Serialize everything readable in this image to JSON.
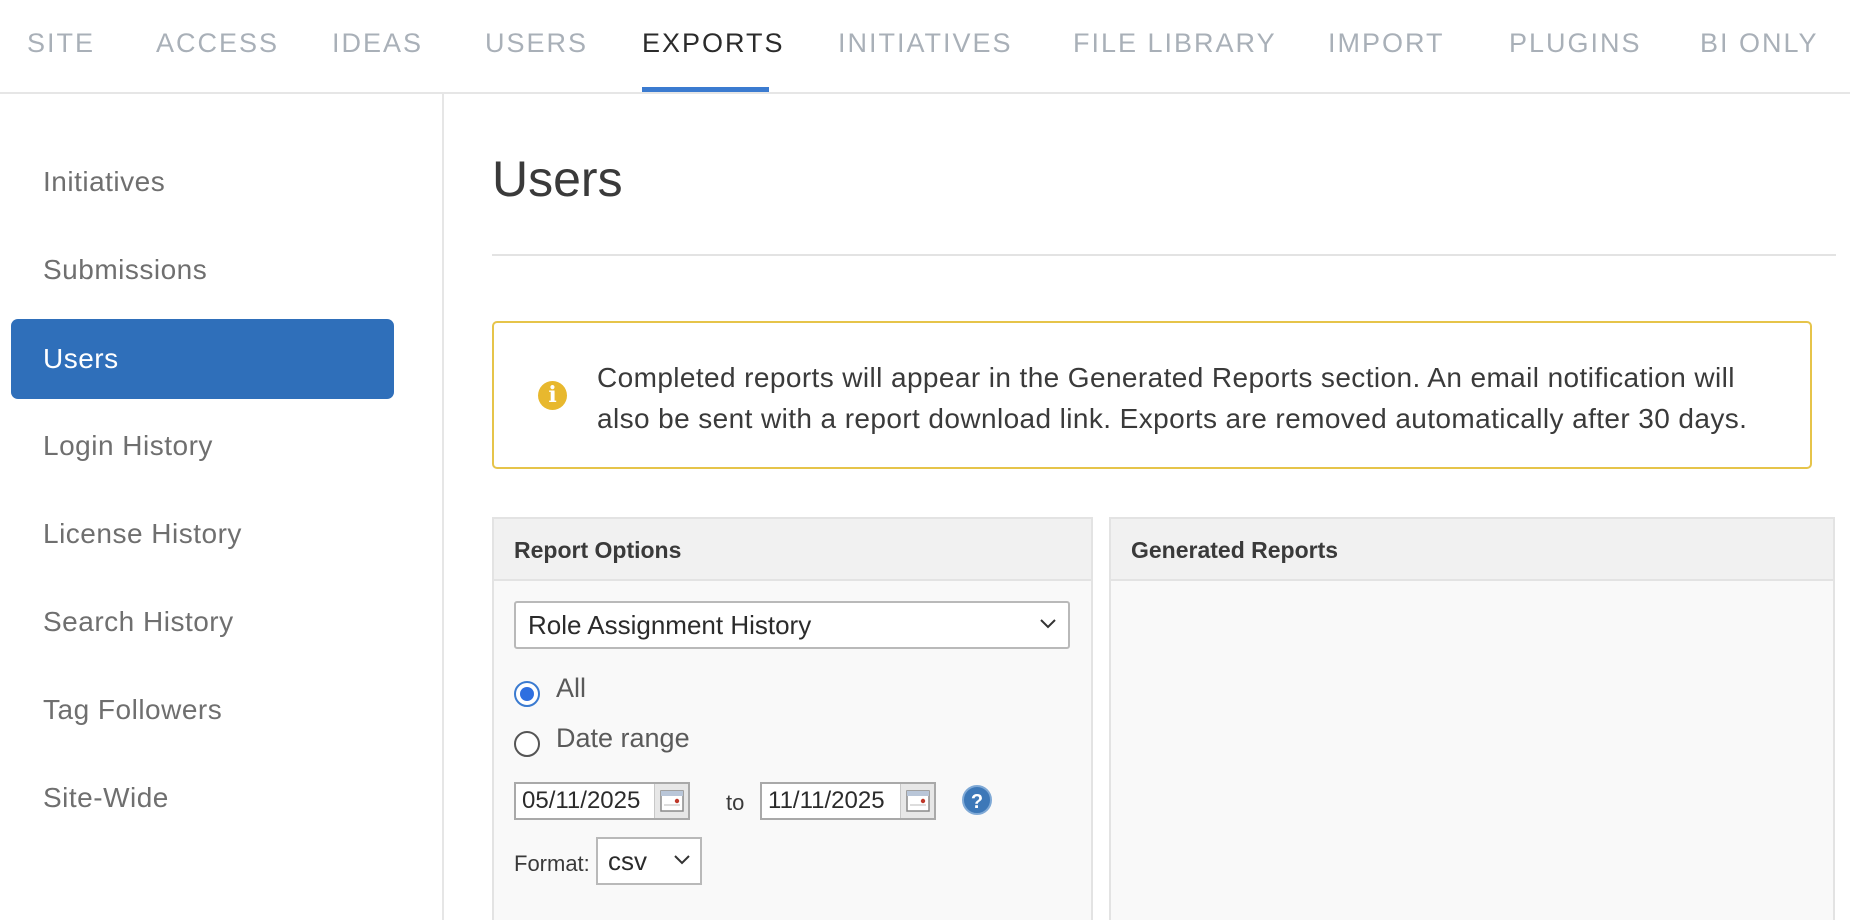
{
  "topnav": {
    "tabs": [
      {
        "label": "SITE"
      },
      {
        "label": "ACCESS"
      },
      {
        "label": "IDEAS"
      },
      {
        "label": "USERS"
      },
      {
        "label": "EXPORTS"
      },
      {
        "label": "INITIATIVES"
      },
      {
        "label": "FILE LIBRARY"
      },
      {
        "label": "IMPORT"
      },
      {
        "label": "PLUGINS"
      },
      {
        "label": "BI ONLY"
      }
    ],
    "active": "EXPORTS",
    "accent_color": "#3b7bd0"
  },
  "sidebar": {
    "items": [
      {
        "label": "Initiatives"
      },
      {
        "label": "Submissions"
      },
      {
        "label": "Users"
      },
      {
        "label": "Login History"
      },
      {
        "label": "License History"
      },
      {
        "label": "Search History"
      },
      {
        "label": "Tag Followers"
      },
      {
        "label": "Site-Wide"
      }
    ],
    "active": "Users",
    "active_color": "#2f6fba"
  },
  "main": {
    "title": "Users",
    "notice": {
      "icon": "info-icon",
      "text": "Completed reports will appear in the Generated Reports section. An email notification will also be sent with a report download link. Exports are removed automatically after 30 days.",
      "border_color": "#e6c44a"
    },
    "report_options": {
      "header": "Report Options",
      "report_type": "Role Assignment History",
      "range_options": [
        {
          "label": "All",
          "checked": true
        },
        {
          "label": "Date range",
          "checked": false
        }
      ],
      "date_from": "05/11/2025",
      "to_label": "to",
      "date_to": "11/11/2025",
      "format_label": "Format:",
      "format_value": "csv"
    },
    "generated_reports": {
      "header": "Generated Reports"
    }
  }
}
